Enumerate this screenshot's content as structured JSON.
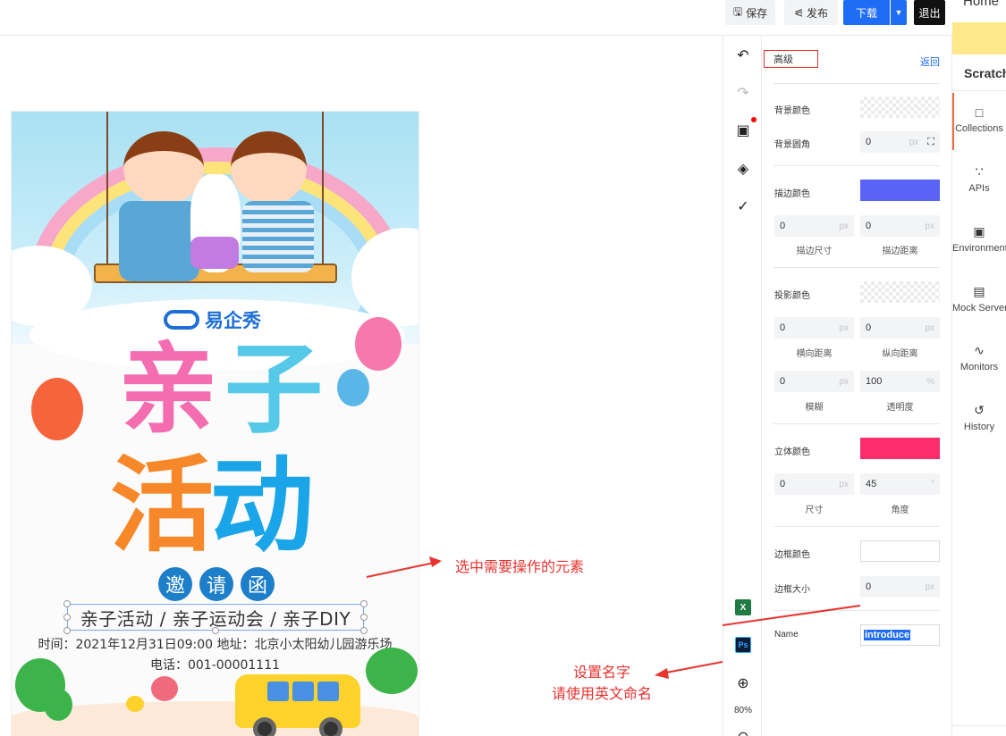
{
  "toolbar": {
    "save": "保存",
    "publish": "发布",
    "download": "下载",
    "exit": "退出"
  },
  "poster": {
    "brand": "易企秀",
    "title_line1": [
      "亲",
      "子"
    ],
    "title_line2": [
      "活",
      "动"
    ],
    "invite_chars": [
      "邀",
      "请",
      "函"
    ],
    "selected_text": "亲子活动 / 亲子运动会 / 亲子DIY",
    "info_line1": "时间：2021年12月31日09:00    地址：北京小太阳幼儿园游乐场",
    "info_line2": "电话：001-00001111",
    "colors": {
      "pink": "#f36db0",
      "cyan": "#56c8e8",
      "orange": "#f7882a",
      "blue": "#1aa5e8"
    }
  },
  "annotations": {
    "select_hint": "选中需要操作的元素",
    "name_hint_line1": "设置名字",
    "name_hint_line2": "请使用英文命名"
  },
  "tools": {
    "zoom": "80%",
    "excel_label": "X",
    "ps_label": "Ps"
  },
  "panel": {
    "tab": "高级",
    "back": "返回",
    "bg_color": "背景颜色",
    "bg_radius": "背景圆角",
    "bg_radius_value": "0",
    "unit_px": "px",
    "unit_pct": "%",
    "unit_deg": "°",
    "stroke_color": "描边颜色",
    "stroke_color_value": "#5b63f6",
    "stroke_size_value": "0",
    "stroke_dist_value": "0",
    "stroke_size": "描边尺寸",
    "stroke_dist": "描边距离",
    "shadow_color": "投影颜色",
    "shadow_h_value": "0",
    "shadow_v_value": "0",
    "shadow_h": "横向距离",
    "shadow_v": "纵向距离",
    "blur_value": "0",
    "opacity_value": "100",
    "blur": "模糊",
    "opacity": "透明度",
    "solid_color": "立体颜色",
    "solid_color_value": "#fd2c6b",
    "size_value": "0",
    "angle_value": "45",
    "size": "尺寸",
    "angle": "角度",
    "border_color": "边框颜色",
    "border_size": "边框大小",
    "border_size_value": "0",
    "name_label": "Name",
    "name_value": "introduce"
  },
  "sidebar": {
    "home": "Home",
    "scratch": "Scratch",
    "items": [
      {
        "label": "Collections",
        "icon": "collections-icon"
      },
      {
        "label": "APIs",
        "icon": "apis-icon"
      },
      {
        "label": "Environments",
        "icon": "environments-icon"
      },
      {
        "label": "Mock Servers",
        "icon": "mock-servers-icon"
      },
      {
        "label": "Monitors",
        "icon": "monitors-icon"
      },
      {
        "label": "History",
        "icon": "history-icon"
      }
    ]
  }
}
